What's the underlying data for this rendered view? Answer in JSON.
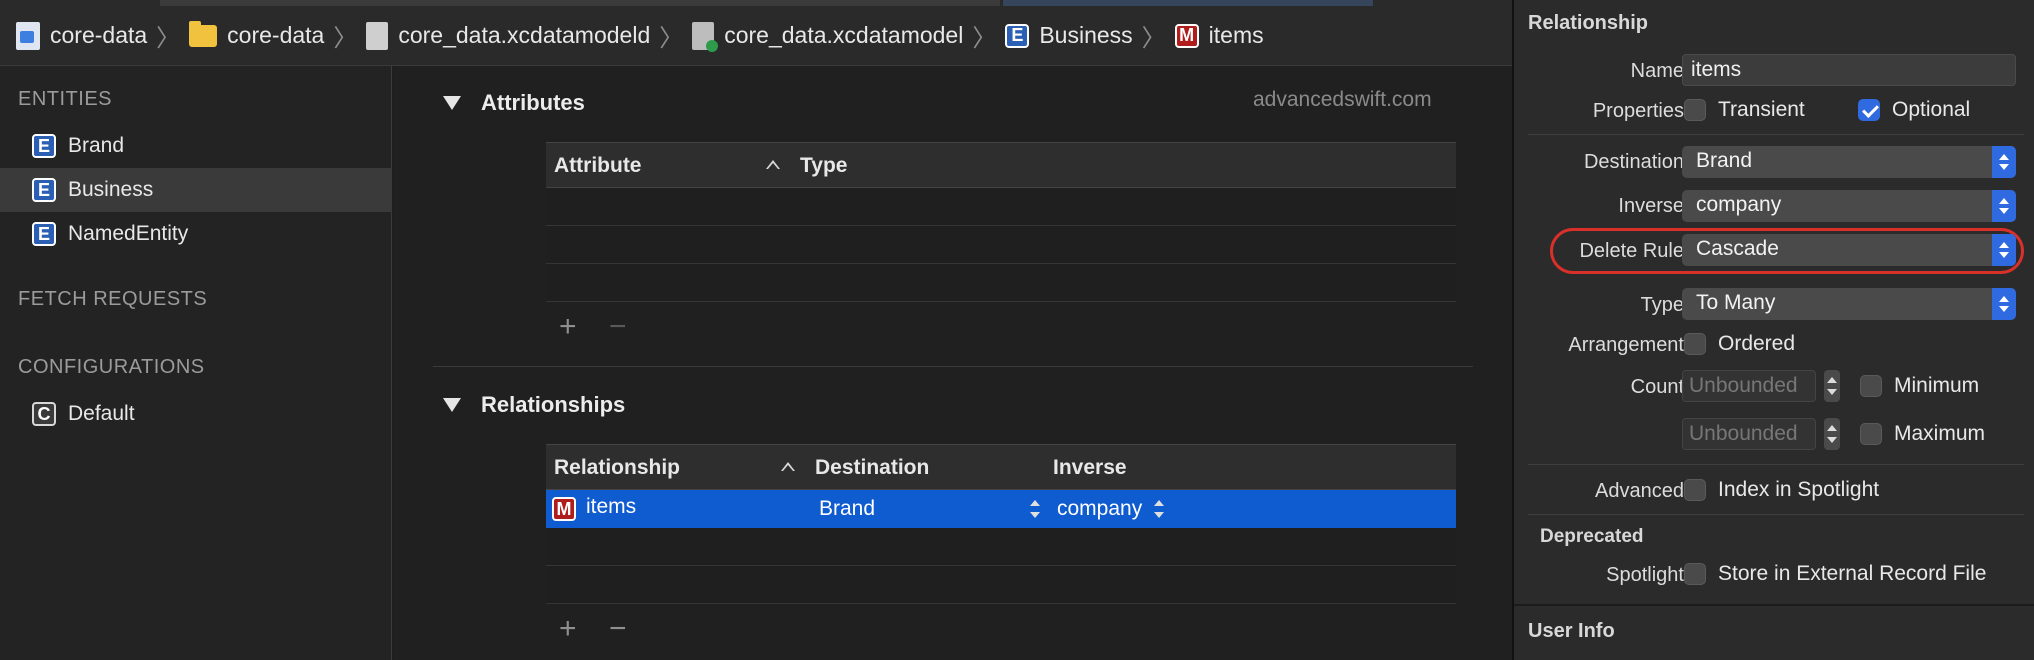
{
  "breadcrumbs": [
    {
      "icon": "xcode-project-icon",
      "label": "core-data"
    },
    {
      "icon": "folder-icon",
      "label": "core-data"
    },
    {
      "icon": "datamodeld-icon",
      "label": "core_data.xcdatamodeld"
    },
    {
      "icon": "datamodel-icon",
      "label": "core_data.xcdatamodel"
    },
    {
      "icon": "entity-icon",
      "badge": "E",
      "label": "Business"
    },
    {
      "icon": "relationship-icon",
      "badge": "M",
      "label": "items"
    }
  ],
  "sidebar": {
    "entities_title": "ENTITIES",
    "entities": [
      {
        "badge": "E",
        "label": "Brand",
        "selected": false
      },
      {
        "badge": "E",
        "label": "Business",
        "selected": true
      },
      {
        "badge": "E",
        "label": "NamedEntity",
        "selected": false
      }
    ],
    "fetch_title": "FETCH REQUESTS",
    "config_title": "CONFIGURATIONS",
    "configurations": [
      {
        "badge": "C",
        "label": "Default"
      }
    ]
  },
  "editor": {
    "watermark": "advancedswift.com",
    "attributes": {
      "title": "Attributes",
      "columns": [
        "Attribute",
        "Type"
      ],
      "add": "+",
      "remove": "−"
    },
    "relationships": {
      "title": "Relationships",
      "columns": [
        "Relationship",
        "Destination",
        "Inverse"
      ],
      "rows": [
        {
          "badge": "M",
          "name": "items",
          "destination": "Brand",
          "inverse": "company",
          "selected": true
        }
      ],
      "add": "+",
      "remove": "−"
    }
  },
  "inspector": {
    "title": "Relationship",
    "name_label": "Name",
    "name_value": "items",
    "properties_label": "Properties",
    "transient_label": "Transient",
    "transient_checked": false,
    "optional_label": "Optional",
    "optional_checked": true,
    "destination_label": "Destination",
    "destination_value": "Brand",
    "inverse_label": "Inverse",
    "inverse_value": "company",
    "delete_rule_label": "Delete Rule",
    "delete_rule_value": "Cascade",
    "type_label": "Type",
    "type_value": "To Many",
    "arrangement_label": "Arrangement",
    "ordered_label": "Ordered",
    "ordered_checked": false,
    "count_label": "Count",
    "count_min_placeholder": "Unbounded",
    "count_max_placeholder": "Unbounded",
    "minimum_label": "Minimum",
    "maximum_label": "Maximum",
    "advanced_label": "Advanced",
    "spotlight_index_label": "Index in Spotlight",
    "deprecated_title": "Deprecated",
    "spotlight_label": "Spotlight",
    "external_record_label": "Store in External Record File",
    "user_info_title": "User Info"
  },
  "colors": {
    "selection": "#0f5bd0",
    "accent": "#2f6ae0",
    "highlight_ring": "#d9302a"
  }
}
